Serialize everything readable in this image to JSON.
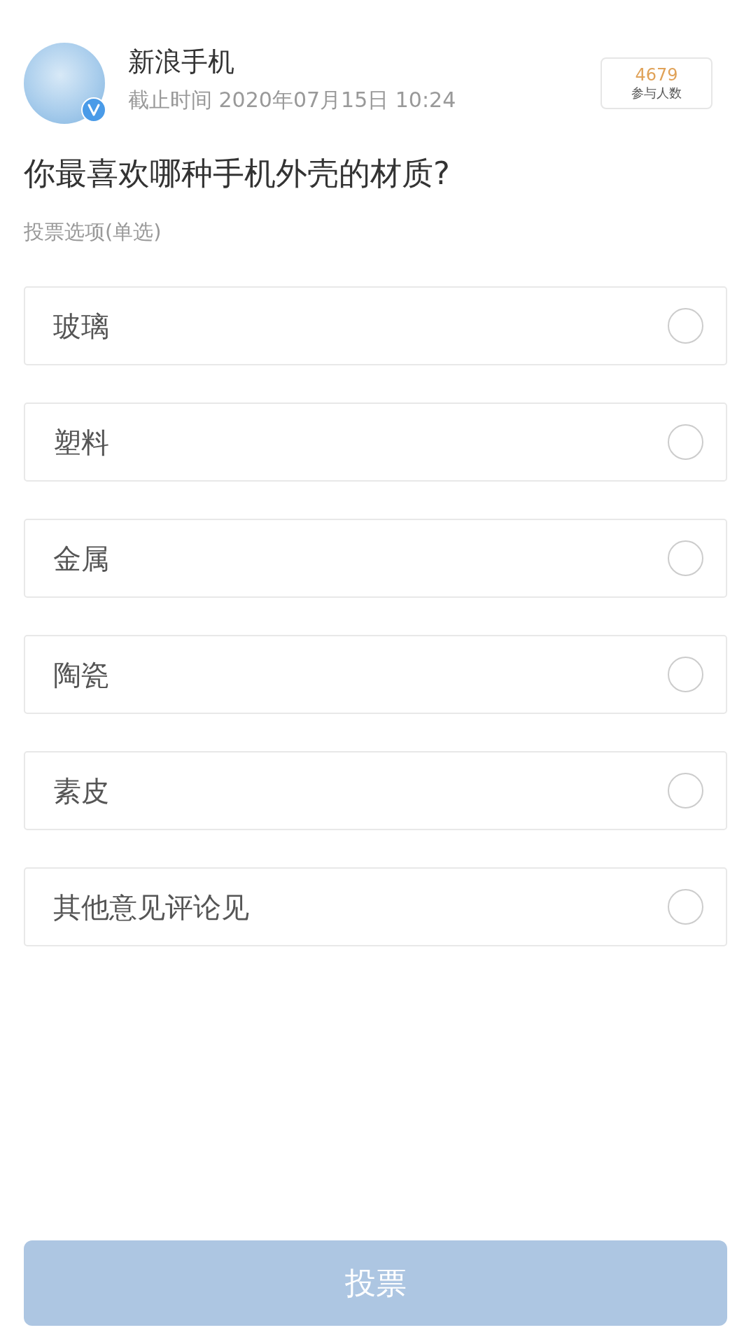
{
  "account": {
    "name": "新浪手机",
    "deadline": "截止时间 2020年07月15日 10:24",
    "verified": true
  },
  "participants": {
    "count": "4679",
    "label": "参与人数"
  },
  "question": "你最喜欢哪种手机外壳的材质?",
  "options_label": "投票选项(单选)",
  "options": [
    {
      "label": "玻璃",
      "selected": false
    },
    {
      "label": "塑料",
      "selected": false
    },
    {
      "label": "金属",
      "selected": false
    },
    {
      "label": "陶瓷",
      "selected": false
    },
    {
      "label": "素皮",
      "selected": false
    },
    {
      "label": "其他意见评论见",
      "selected": false
    }
  ],
  "vote_button": {
    "label": "投票",
    "disabled": true
  }
}
